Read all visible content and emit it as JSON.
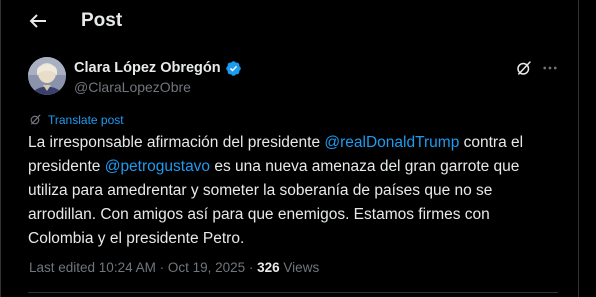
{
  "header": {
    "title": "Post"
  },
  "author": {
    "display_name": "Clara López Obregón",
    "handle": "@ClaraLopezObre",
    "verified": true
  },
  "post": {
    "translate_label": "Translate post",
    "lines": [
      [
        {
          "text": "La irresponsable afirmación del presidente ",
          "type": "text"
        },
        {
          "text": "@realDonaldTrump",
          "type": "mention"
        },
        {
          "text": " contra el",
          "type": "text"
        }
      ],
      [
        {
          "text": "presidente ",
          "type": "text"
        },
        {
          "text": "@petrogustavo",
          "type": "mention"
        },
        {
          "text": " es una nueva amenaza del gran garrote que",
          "type": "text"
        }
      ],
      [
        {
          "text": "utiliza para amedrentar y someter la soberanía de países que no se",
          "type": "text"
        }
      ],
      [
        {
          "text": "arrodillan. Con amigos así para que enemigos. Estamos firmes con",
          "type": "text"
        }
      ],
      [
        {
          "text": "Colombia y el presidente Petro.",
          "type": "text"
        }
      ]
    ]
  },
  "meta": {
    "edited_label": "Last edited 10:24 AM · Oct 19, 2025 · ",
    "views_count": "326",
    "views_label": " Views"
  },
  "icons": {
    "back": "arrow-left-icon",
    "verified": "verified-badge-icon",
    "grok": "grok-icon",
    "more": "more-horizontal-icon",
    "translate": "translate-icon"
  },
  "colors": {
    "background": "#000000",
    "text": "#e7e9ea",
    "muted": "#71767b",
    "accent": "#1d9bf0",
    "border": "#2f3336"
  }
}
